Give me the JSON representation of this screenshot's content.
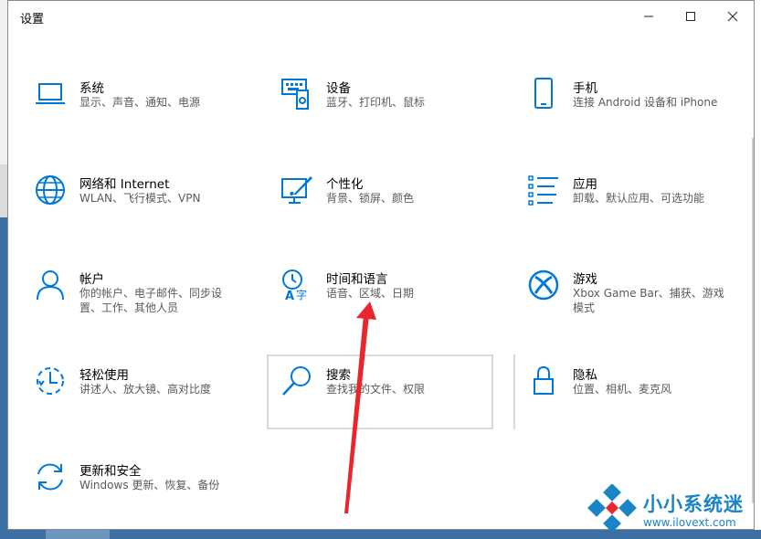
{
  "window": {
    "title": "设置",
    "controls": {
      "minimize": "—",
      "maximize": "☐",
      "close": "✕"
    }
  },
  "settings": [
    {
      "name": "系统",
      "desc": "显示、声音、通知、电源",
      "icon": "laptop-icon"
    },
    {
      "name": "设备",
      "desc": "蓝牙、打印机、鼠标",
      "icon": "devices-icon"
    },
    {
      "name": "手机",
      "desc": "连接 Android 设备和 iPhone",
      "icon": "phone-icon"
    },
    {
      "name": "网络和 Internet",
      "desc": "WLAN、飞行模式、VPN",
      "icon": "globe-icon"
    },
    {
      "name": "个性化",
      "desc": "背景、锁屏、颜色",
      "icon": "personalization-icon"
    },
    {
      "name": "应用",
      "desc": "卸载、默认应用、可选功能",
      "icon": "apps-list-icon"
    },
    {
      "name": "帐户",
      "desc": "你的帐户、电子邮件、同步设置、工作、其他人员",
      "icon": "person-icon"
    },
    {
      "name": "时间和语言",
      "desc": "语音、区域、日期",
      "icon": "time-language-icon"
    },
    {
      "name": "游戏",
      "desc": "Xbox Game Bar、捕获、游戏模式",
      "icon": "xbox-icon"
    },
    {
      "name": "轻松使用",
      "desc": "讲述人、放大镜、高对比度",
      "icon": "ease-of-access-icon"
    },
    {
      "name": "搜索",
      "desc": "查找我的文件、权限",
      "icon": "search-icon"
    },
    {
      "name": "隐私",
      "desc": "位置、相机、麦克风",
      "icon": "lock-icon"
    },
    {
      "name": "更新和安全",
      "desc": "Windows 更新、恢复、备份",
      "icon": "sync-icon"
    }
  ],
  "watermark": {
    "name": "小小系统迷",
    "url": "www.ilovext.com"
  },
  "colors": {
    "accent": "#0078d7",
    "arrow": "#e8262b",
    "watermark": "#1a84c8"
  }
}
